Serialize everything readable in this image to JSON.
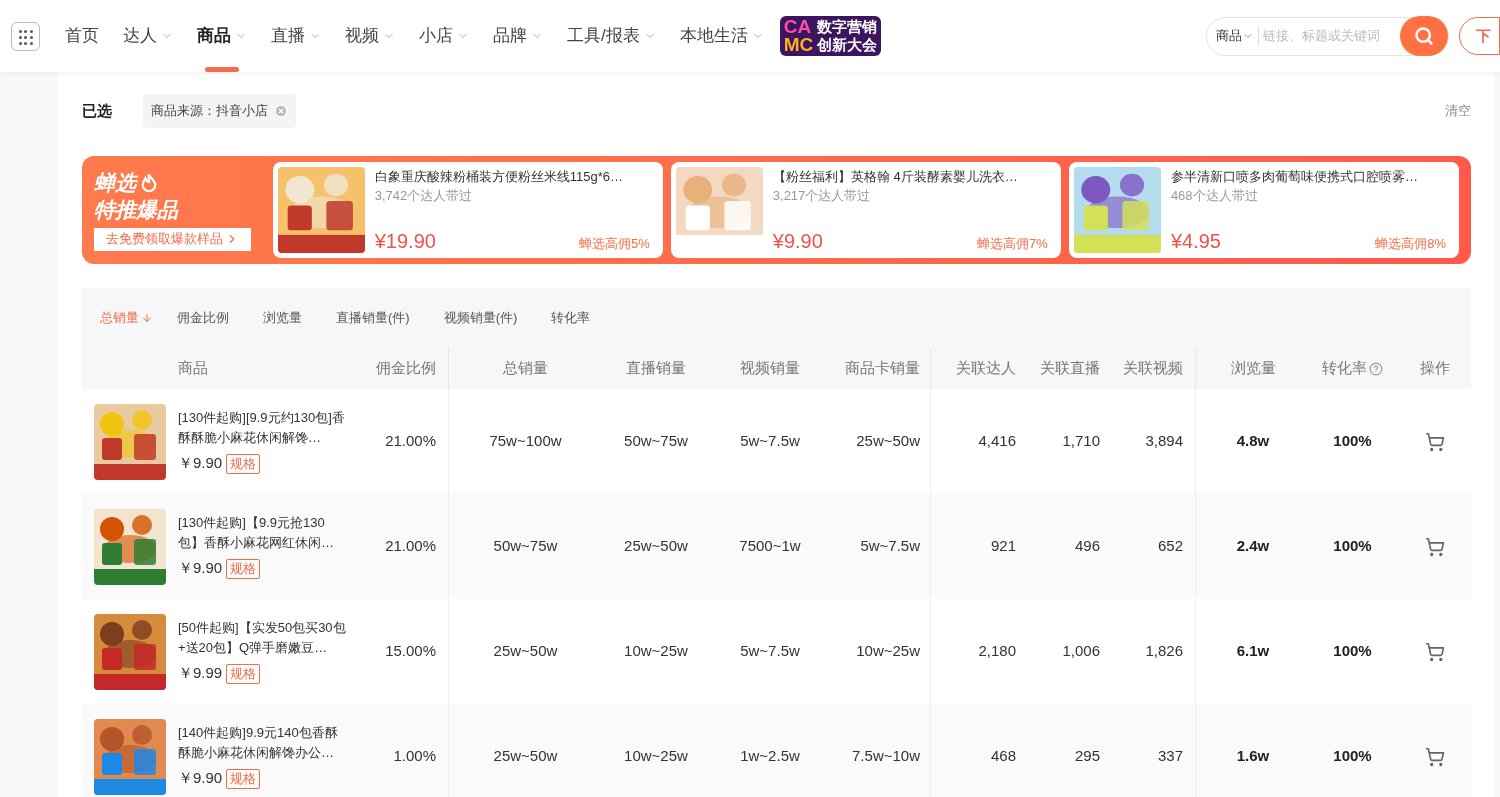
{
  "nav": {
    "items": [
      {
        "label": "首页",
        "has_menu": false,
        "selected": false
      },
      {
        "label": "达人",
        "has_menu": true,
        "selected": false
      },
      {
        "label": "商品",
        "has_menu": true,
        "selected": true
      },
      {
        "label": "直播",
        "has_menu": true,
        "selected": false
      },
      {
        "label": "视频",
        "has_menu": true,
        "selected": false
      },
      {
        "label": "小店",
        "has_menu": true,
        "selected": false
      },
      {
        "label": "品牌",
        "has_menu": true,
        "selected": false
      },
      {
        "label": "工具/报表",
        "has_menu": true,
        "selected": false
      },
      {
        "label": "本地生活",
        "has_menu": true,
        "selected": false
      }
    ],
    "logo": {
      "letters_top": "CA",
      "letters_bottom": "MC",
      "line_1": "数字营销",
      "line_2": "创新大会"
    },
    "search": {
      "scope": "商品",
      "placeholder": "链接、标题或关键词"
    },
    "download_button": "下"
  },
  "filters": {
    "label": "已选",
    "chips": [
      "商品来源：抖音小店"
    ],
    "clear": "清空"
  },
  "banner": {
    "title_1": "蝉选",
    "title_2": "特推爆品",
    "cta": "去免费领取爆款样品",
    "cards": [
      {
        "title": "白象重庆酸辣粉桶装方便粉丝米线115g*6…",
        "count": "3,742个达人带过",
        "price": "¥19.90",
        "commission": "蝉选高佣5%"
      },
      {
        "title": "【粉丝福利】英格翰 4斤装酵素婴儿洗衣…",
        "count": "3,217个达人带过",
        "price": "¥9.90",
        "commission": "蝉选高佣7%"
      },
      {
        "title": "参半清新口喷多肉葡萄味便携式口腔喷雾…",
        "count": "468个达人带过",
        "price": "¥4.95",
        "commission": "蝉选高佣8%"
      }
    ]
  },
  "sort_tabs": [
    {
      "label": "总销量",
      "selected": true
    },
    {
      "label": "佣金比例",
      "selected": false
    },
    {
      "label": "浏览量",
      "selected": false
    },
    {
      "label": "直播销量(件)",
      "selected": false
    },
    {
      "label": "视频销量(件)",
      "selected": false
    },
    {
      "label": "转化率",
      "selected": false
    }
  ],
  "table": {
    "columns": [
      "商品",
      "佣金比例",
      "总销量",
      "直播销量",
      "视频销量",
      "商品卡销量",
      "关联达人",
      "关联直播",
      "关联视频",
      "浏览量",
      "转化率",
      "操作"
    ],
    "rows": [
      {
        "title": "[130件起购][9.9元约130包]香酥酥脆小麻花休闲解馋…",
        "price": "￥9.90",
        "spec": "规格",
        "commission": "21.00%",
        "total": "75w~100w",
        "live": "50w~75w",
        "video": "5w~7.5w",
        "card": "25w~50w",
        "influencers": "4,416",
        "lives": "1,710",
        "videos": "3,894",
        "views": "4.8w",
        "conversion": "100%"
      },
      {
        "title": "[130件起购]【9.9元抢130包】香酥小麻花网红休闲…",
        "price": "￥9.90",
        "spec": "规格",
        "commission": "21.00%",
        "total": "50w~75w",
        "live": "25w~50w",
        "video": "7500~1w",
        "card": "5w~7.5w",
        "influencers": "921",
        "lives": "496",
        "videos": "652",
        "views": "2.4w",
        "conversion": "100%"
      },
      {
        "title": "[50件起购]【实发50包买30包+送20包】Q弹手磨嫩豆…",
        "price": "￥9.99",
        "spec": "规格",
        "commission": "15.00%",
        "total": "25w~50w",
        "live": "10w~25w",
        "video": "5w~7.5w",
        "card": "10w~25w",
        "influencers": "2,180",
        "lives": "1,006",
        "videos": "1,826",
        "views": "6.1w",
        "conversion": "100%"
      },
      {
        "title": "[140件起购]9.9元140包香酥酥脆小麻花休闲解馋办公…",
        "price": "￥9.90",
        "spec": "规格",
        "commission": "1.00%",
        "total": "25w~50w",
        "live": "10w~25w",
        "video": "1w~2.5w",
        "card": "7.5w~10w",
        "influencers": "468",
        "lives": "295",
        "videos": "337",
        "views": "1.6w",
        "conversion": "100%"
      }
    ]
  }
}
